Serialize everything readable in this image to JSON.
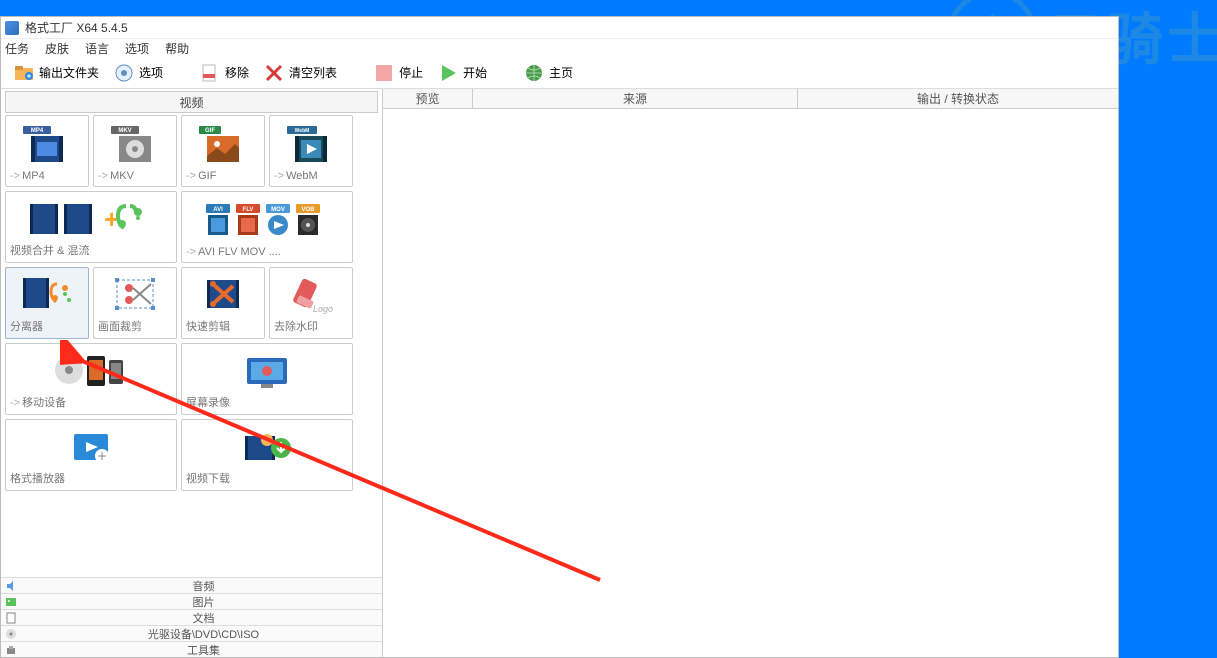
{
  "titlebar": {
    "title": "格式工厂 X64 5.4.5"
  },
  "menubar": {
    "items": [
      "任务",
      "皮肤",
      "语言",
      "选项",
      "帮助"
    ]
  },
  "toolbar": {
    "output_folder": "输出文件夹",
    "options": "选项",
    "remove": "移除",
    "clear_list": "清空列表",
    "stop": "停止",
    "start": "开始",
    "homepage": "主页"
  },
  "left": {
    "active_category": "视频",
    "tiles_row1": [
      {
        "label": "MP4",
        "arrow": true
      },
      {
        "label": "MKV",
        "arrow": true
      },
      {
        "label": "GIF",
        "arrow": true
      },
      {
        "label": "WebM",
        "arrow": true
      }
    ],
    "tiles_row2": [
      {
        "label": "视频合并 & 混流",
        "wide": true
      },
      {
        "label": "AVI FLV MOV ....",
        "arrow": true,
        "wide": true
      }
    ],
    "tiles_row3": [
      {
        "label": "分离器",
        "selected": true
      },
      {
        "label": "画面裁剪"
      },
      {
        "label": "快速剪辑"
      },
      {
        "label": "去除水印"
      }
    ],
    "tiles_row4": [
      {
        "label": "移动设备",
        "arrow": true,
        "wide": true
      },
      {
        "label": "屏幕录像",
        "wide": true
      }
    ],
    "tiles_row5": [
      {
        "label": "格式播放器",
        "wide": true
      },
      {
        "label": "视频下载",
        "wide": true
      }
    ],
    "categories": [
      "音频",
      "图片",
      "文档",
      "光驱设备\\DVD\\CD\\ISO",
      "工具集"
    ]
  },
  "columns": {
    "preview": "预览",
    "source": "来源",
    "output": "输出 / 转换状态"
  },
  "watermark": {
    "text": "云骑士"
  }
}
